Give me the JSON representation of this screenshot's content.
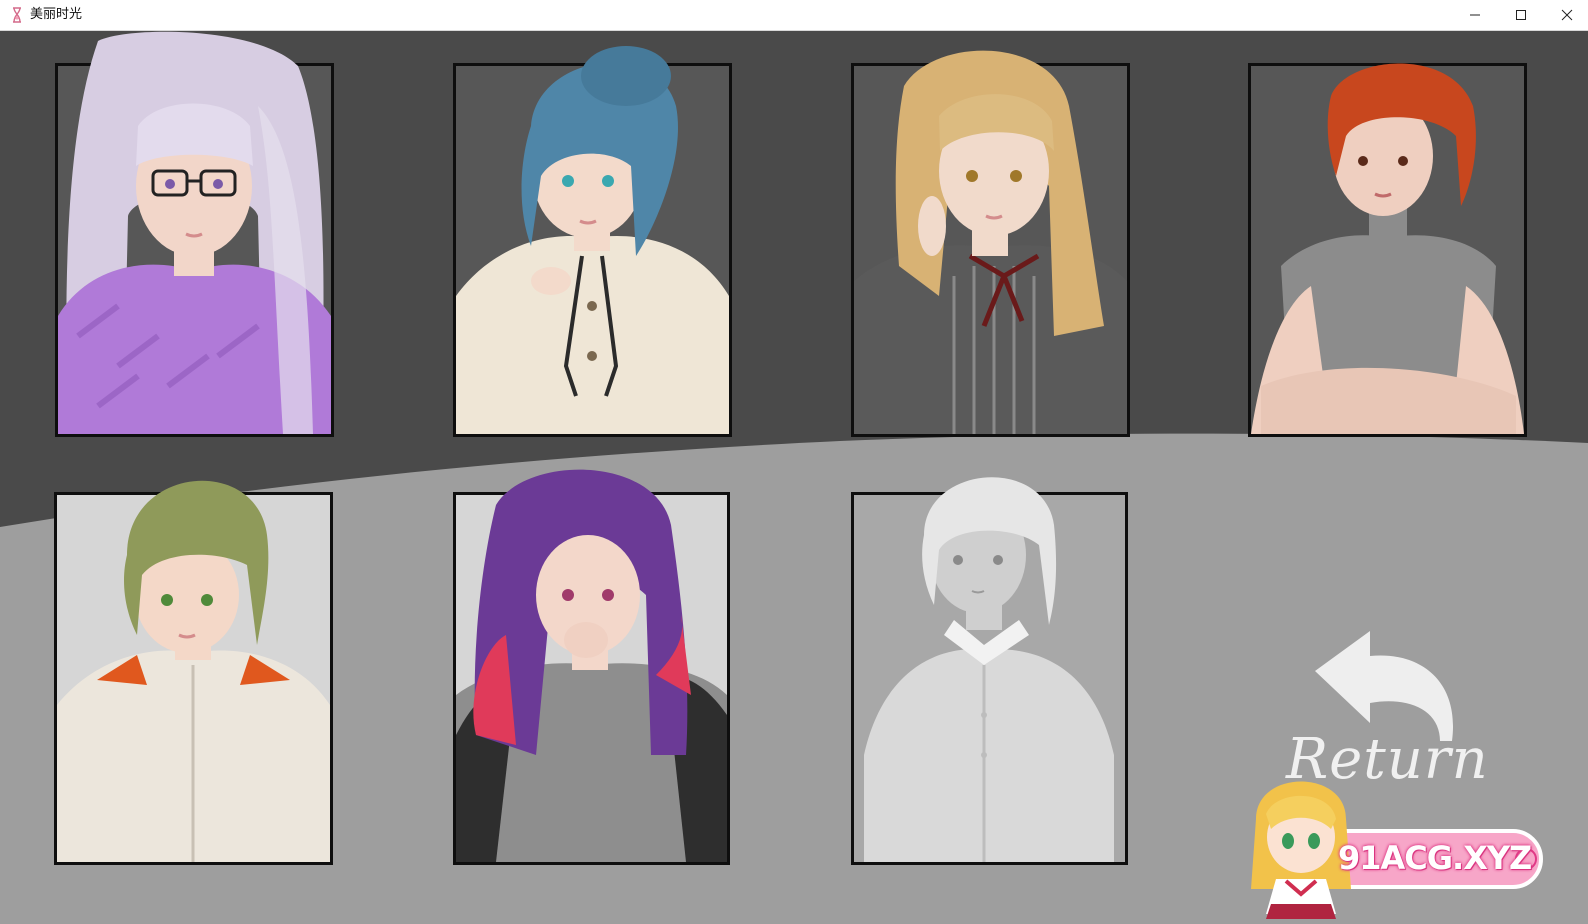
{
  "window": {
    "title": "美丽时光"
  },
  "colors": {
    "bg_dark": "#4a4a4a",
    "bg_light": "#9e9e9e",
    "card_border": "#0e0e0e",
    "return_color": "#f0f0f0",
    "watermark_pink": "#f7a6c8"
  },
  "characters": [
    {
      "id": "char-1",
      "hair": "#d7cde2",
      "outfit": "#b07ad8",
      "skin": "#f2d6c9",
      "accessory": "glasses",
      "selectable": true
    },
    {
      "id": "char-2",
      "hair": "#4f86a8",
      "outfit": "#efe6d6",
      "skin": "#f3dacb",
      "accessory": "ribbon",
      "selectable": true
    },
    {
      "id": "char-3",
      "hair": "#d8b274",
      "outfit": "#5a5a5a",
      "skin": "#f1dacb",
      "accessory": "ribbon",
      "selectable": true
    },
    {
      "id": "char-4",
      "hair": "#c8471e",
      "outfit": "#8c8c8c",
      "skin": "#efcfc0",
      "accessory": "none",
      "selectable": true
    },
    {
      "id": "char-5",
      "hair": "#8f9a5a",
      "outfit": "#ece6dc",
      "skin": "#f4d8c8",
      "accessory": "hood",
      "selectable": true
    },
    {
      "id": "char-6",
      "hair": "#6b3a96",
      "outfit": "#8e8e8e",
      "skin": "#f3d7ca",
      "accessory": "jacket",
      "selectable": true
    },
    {
      "id": "char-7",
      "hair": "#dcdcdc",
      "outfit": "#d9d9d9",
      "skin": "#cfcfcf",
      "accessory": "shirt",
      "selectable": false
    }
  ],
  "return_button": {
    "label": "Return"
  },
  "watermark": {
    "text": "91ACG.XYZ"
  }
}
